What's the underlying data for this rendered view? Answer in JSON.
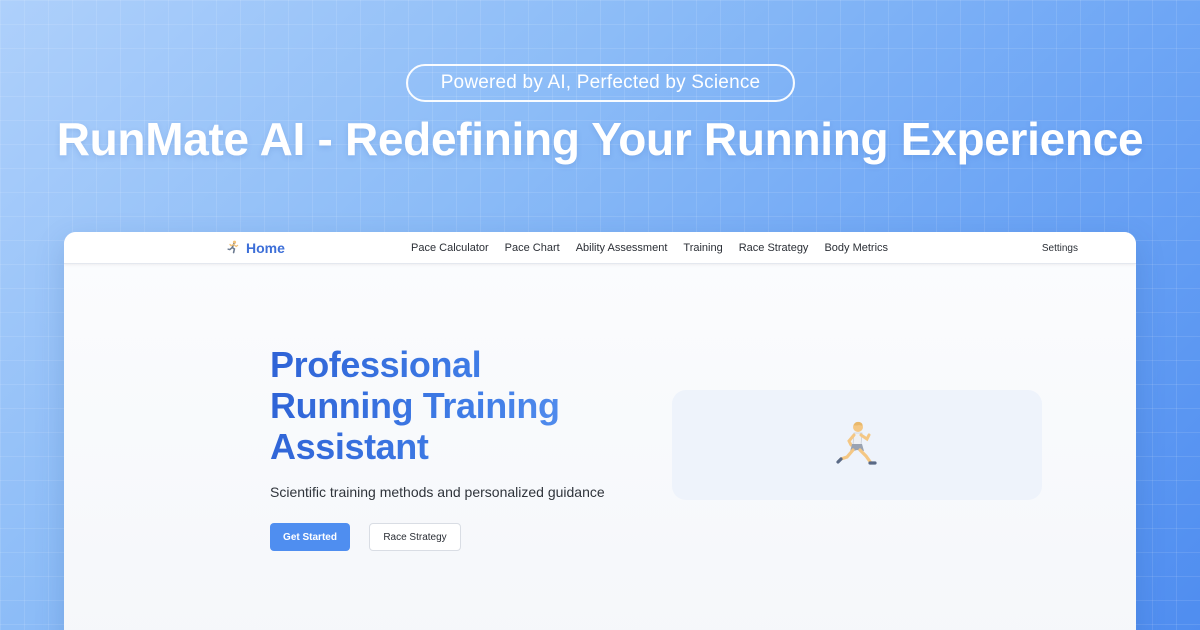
{
  "tagline": "Powered by AI, Perfected by Science",
  "hero_title": "RunMate AI - Redefining Your Running Experience",
  "app": {
    "brand": {
      "icon": "runner-icon",
      "label": "Home"
    },
    "nav": [
      {
        "label": "Pace Calculator"
      },
      {
        "label": "Pace Chart"
      },
      {
        "label": "Ability Assessment"
      },
      {
        "label": "Training"
      },
      {
        "label": "Race Strategy"
      },
      {
        "label": "Body Metrics"
      }
    ],
    "settings_label": "Settings",
    "main": {
      "headline": "Professional Running Training Assistant",
      "subtitle": "Scientific training methods and personalized guidance",
      "primary_button": "Get Started",
      "secondary_button": "Race Strategy",
      "illustration_icon": "runner-icon"
    }
  },
  "colors": {
    "accent": "#3d6fd8",
    "primary_button": "#4f8ef0",
    "background_light": "#aed0fb",
    "background_dark": "#4f8df0"
  }
}
